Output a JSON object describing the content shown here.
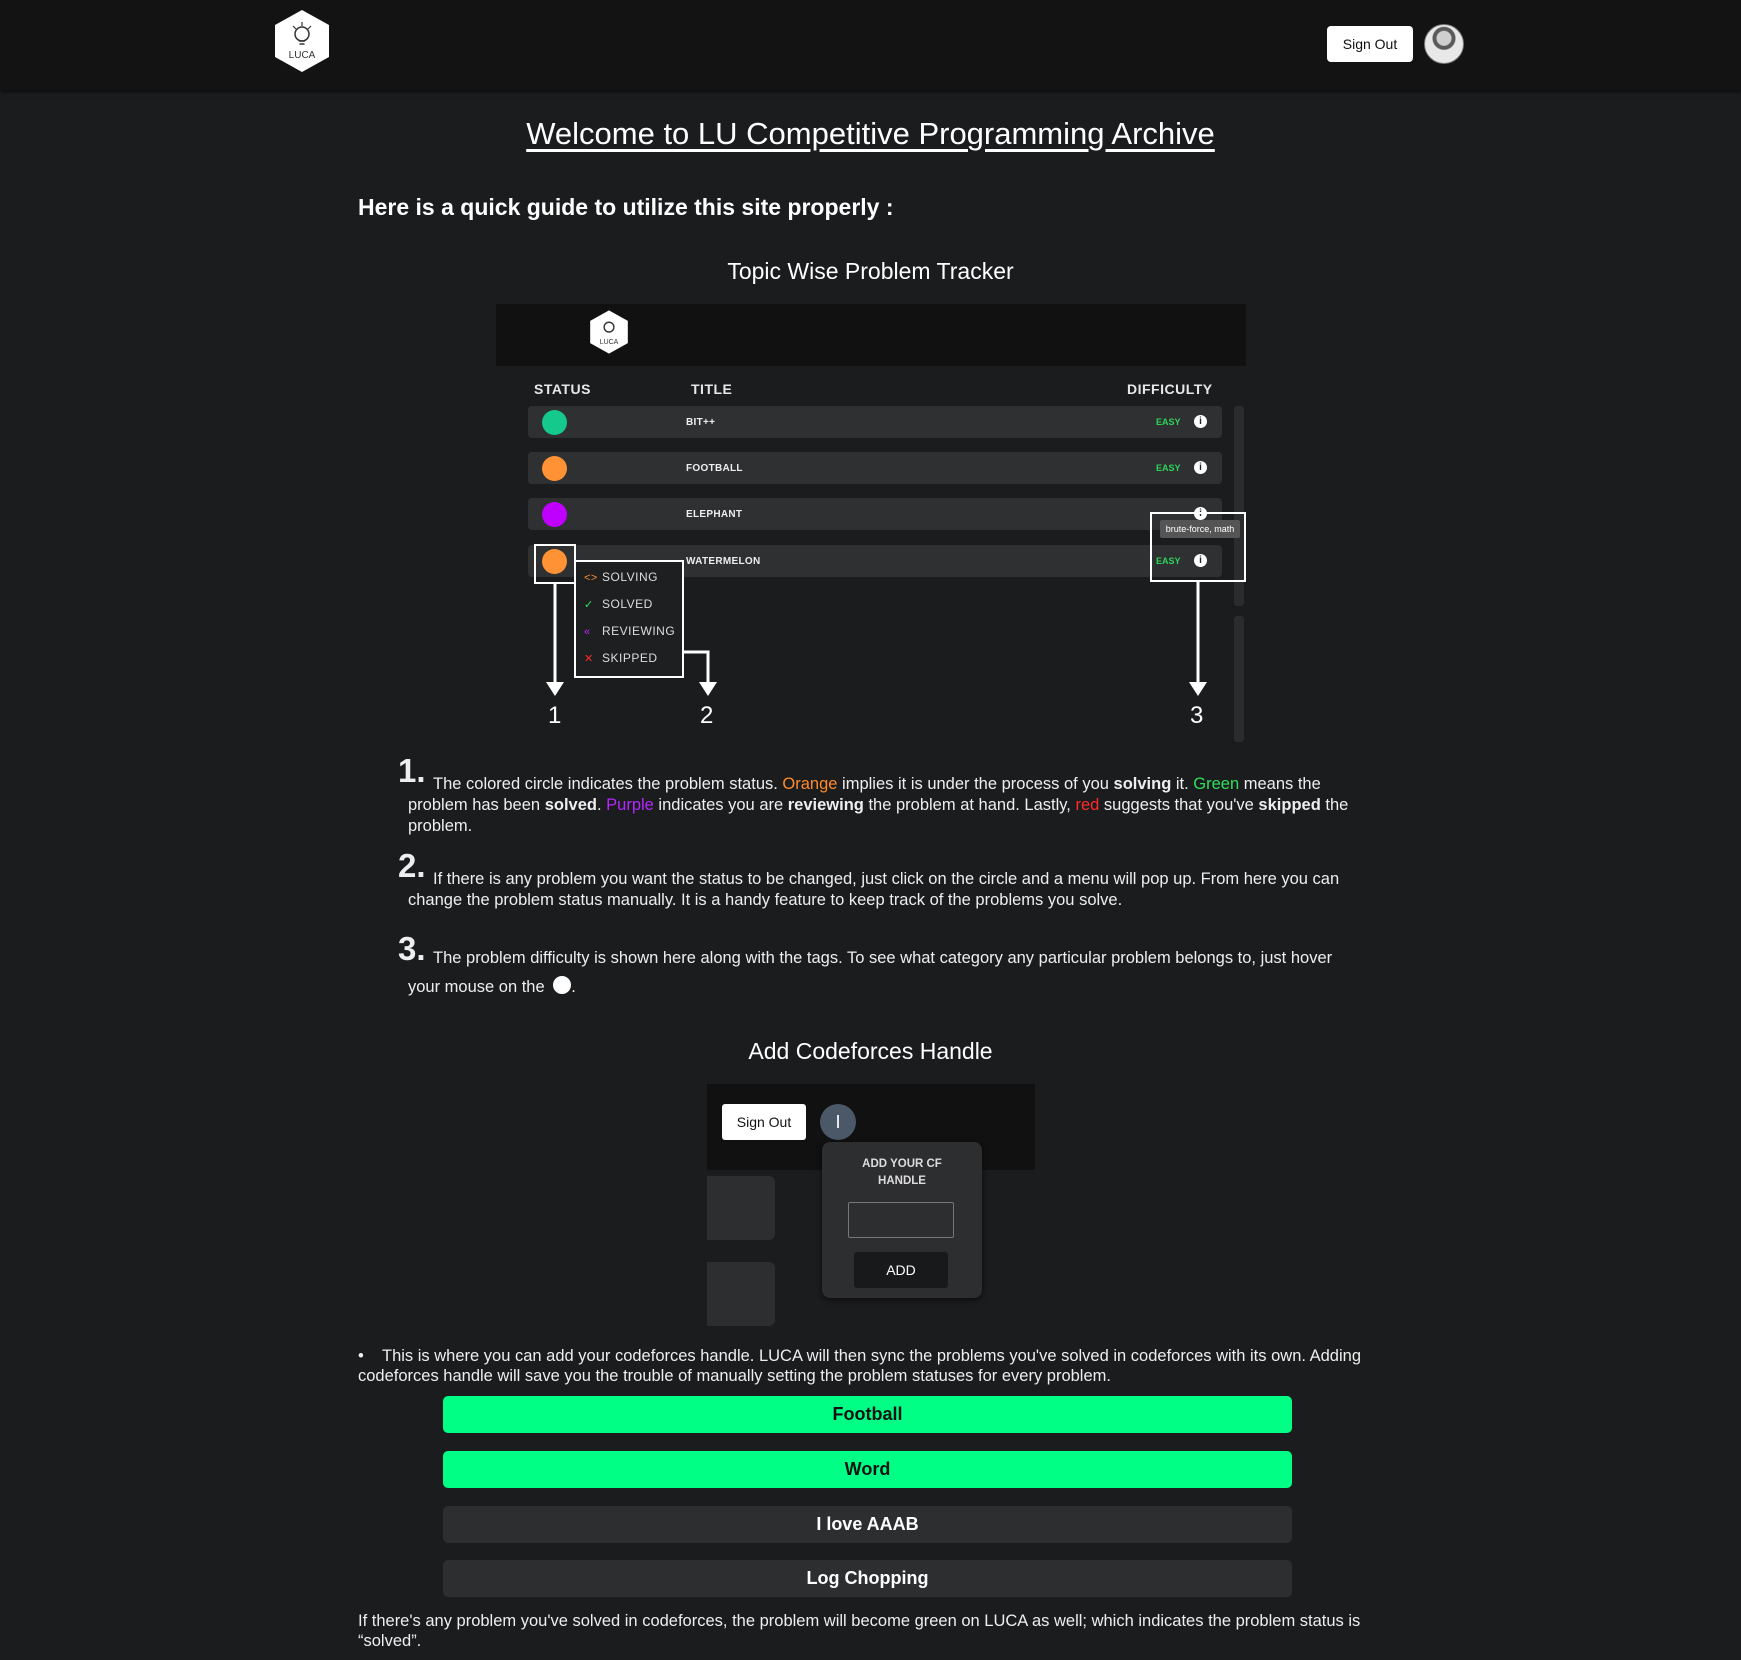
{
  "header": {
    "logo_text": "LUCA",
    "signout_label": "Sign Out"
  },
  "page": {
    "title": "Welcome to LU Competitive Programming Archive",
    "intro": "Here is a quick guide to utilize this site properly :"
  },
  "tracker": {
    "section_title": "Topic Wise Problem Tracker",
    "columns": {
      "status": "STATUS",
      "title": "TITLE",
      "difficulty": "DIFFICULTY"
    },
    "rows": [
      {
        "title": "BIT++",
        "difficulty": "EASY",
        "status_color": "#14c98b"
      },
      {
        "title": "FOOTBALL",
        "difficulty": "EASY",
        "status_color": "#ff9234"
      },
      {
        "title": "ELEPHANT",
        "difficulty": "",
        "status_color": "#c000ff"
      },
      {
        "title": "WATERMELON",
        "difficulty": "EASY",
        "status_color": "#ff9234"
      }
    ],
    "status_menu": [
      {
        "label": "SOLVING",
        "icon": "code-brackets-icon",
        "color": "#ff8a2a"
      },
      {
        "label": "SOLVED",
        "icon": "check-icon",
        "color": "#2fe05c"
      },
      {
        "label": "REVIEWING",
        "icon": "rewind-icon",
        "color": "#b428ff"
      },
      {
        "label": "SKIPPED",
        "icon": "cross-icon",
        "color": "#ff2b2b"
      }
    ],
    "tooltip": "brute-force, math",
    "callouts": [
      "1",
      "2",
      "3"
    ]
  },
  "steps": [
    {
      "number": "1.",
      "parts": {
        "a": "The colored circle indicates the problem status. ",
        "orange": "Orange",
        "b": " implies it is under the process of you ",
        "solving": "solving",
        "c": " it. ",
        "green": "Green",
        "d": " means the problem has been ",
        "solved": "solved",
        "e": ". ",
        "purple": "Purple",
        "f": " indicates you are ",
        "reviewing": "reviewing",
        "g": " the problem at hand. Lastly, ",
        "red": "red",
        "h": " suggests that you've ",
        "skipped": "skipped",
        "i": " the problem."
      }
    },
    {
      "number": "2.",
      "text": "If there is any problem you want the status to be changed, just click on the circle and a menu will pop up. From here you can change the problem status manually. It is a handy feature to keep track of the problems you solve."
    },
    {
      "number": "3.",
      "text": "The problem difficulty is shown here along with the tags. To see what category any particular problem belongs to, just hover your mouse on the",
      "end": "."
    }
  ],
  "cf": {
    "section_title": "Add Codeforces Handle",
    "signout_label": "Sign Out",
    "avatar_initial": "I",
    "panel_label": "ADD YOUR CF HANDLE",
    "input_value": "",
    "add_label": "ADD"
  },
  "bottom": {
    "bullet_text": "This is where you can add your codeforces handle. LUCA will then sync the problems you've solved in codeforces with its own. Adding codeforces handle will save you the trouble of manually setting the problem statuses for every problem.",
    "problems": [
      {
        "title": "Football",
        "solved": true
      },
      {
        "title": "Word",
        "solved": true
      },
      {
        "title": "I love AAAB",
        "solved": false
      },
      {
        "title": "Log Chopping",
        "solved": false
      }
    ],
    "closing_text": "If there's any problem you've solved in codeforces, the problem will become green on LUCA as well; which indicates the problem status is “solved”."
  },
  "colors": {
    "solved_green": "#00ff85",
    "background": "#1b1c1e",
    "orange": "#ff8a2a",
    "green": "#2fe05c",
    "purple": "#b428ff",
    "red": "#ff2b2b"
  }
}
